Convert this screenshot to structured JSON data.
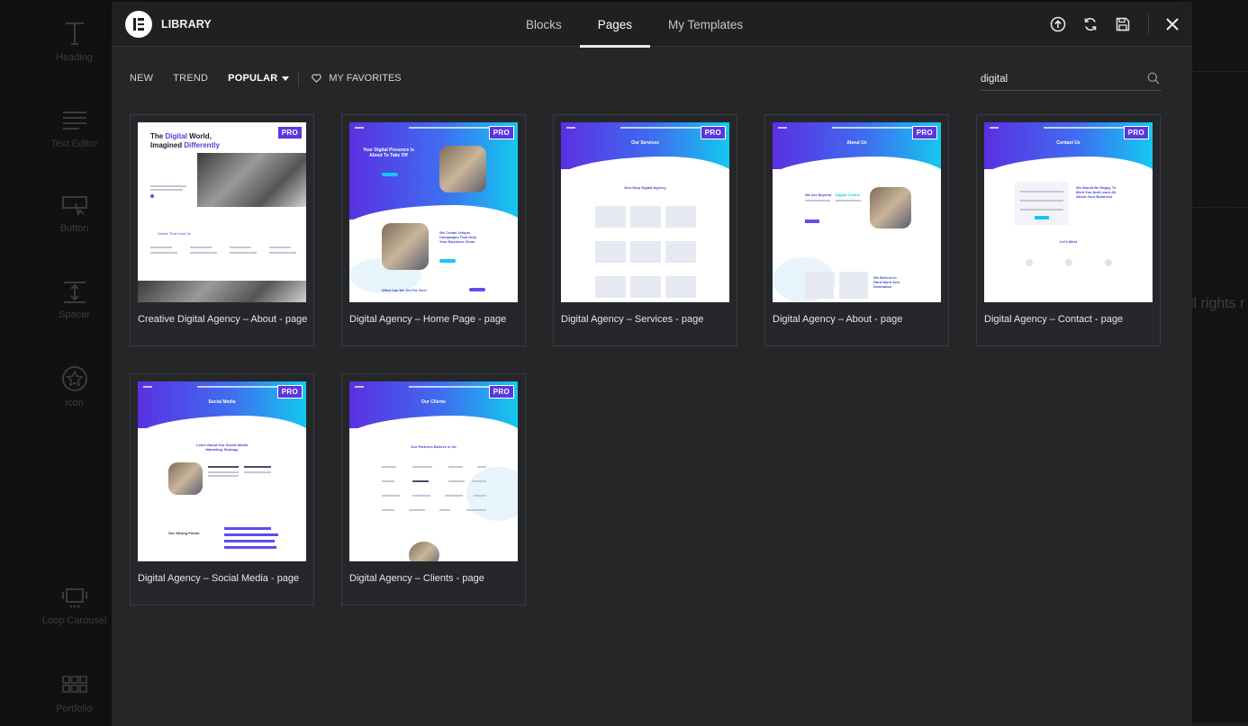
{
  "editor_sidebar": {
    "widgets": [
      {
        "label": "Heading",
        "icon": "heading-icon"
      },
      {
        "label": "Text Editor",
        "icon": "text-editor-icon"
      },
      {
        "label": "Button",
        "icon": "button-icon"
      },
      {
        "label": "Spacer",
        "icon": "spacer-icon"
      },
      {
        "label": "Icon",
        "icon": "star-icon"
      },
      {
        "label": "Loop Carousel",
        "icon": "carousel-icon"
      },
      {
        "label": "Portfolio",
        "icon": "grid-icon"
      }
    ]
  },
  "canvas": {
    "footer_text": "ll rights r"
  },
  "modal": {
    "brand": "LIBRARY",
    "tabs": [
      {
        "label": "Blocks",
        "active": false
      },
      {
        "label": "Pages",
        "active": true
      },
      {
        "label": "My Templates",
        "active": false
      }
    ],
    "header_icons": [
      "upload-icon",
      "sync-icon",
      "save-icon",
      "close-icon"
    ],
    "filters": {
      "new": "NEW",
      "trend": "TREND",
      "popular": "POPULAR",
      "favorites": "MY FAVORITES"
    },
    "search": {
      "value": "digital",
      "placeholder": "Search"
    },
    "badge": "PRO",
    "templates": [
      {
        "title": "Creative Digital Agency – About - page",
        "pro": true
      },
      {
        "title": "Digital Agency – Home Page - page",
        "pro": true
      },
      {
        "title": "Digital Agency – Services - page",
        "pro": true
      },
      {
        "title": "Digital Agency – About - page",
        "pro": true
      },
      {
        "title": "Digital Agency – Contact - page",
        "pro": true
      },
      {
        "title": "Digital Agency – Social Media - page",
        "pro": true
      },
      {
        "title": "Digital Agency – Clients - page",
        "pro": true
      }
    ],
    "thumb_text": {
      "t0_l1a": "The ",
      "t0_l1b": "Digital",
      "t0_l1c": " World,",
      "t0_l2a": "Imagined ",
      "t0_l2b": "Differently",
      "t0_values": "Values That Lead Us",
      "t1_h1": "Your Digital Presence Is",
      "t1_h2": "About To Take Off",
      "t1_h3": "We Create Unique",
      "t1_h4": "Campaigns That Help",
      "t1_h5": "Your Business Grow",
      "t1_h6": "What Can We Do For You?",
      "t2_hero": "Our Services",
      "t2_h": "One-Stop Digital Agency",
      "t3_hero": "About Us",
      "t3_h1": "We Are Beyond",
      "t3_h2": "Digital Centric",
      "t3_h3": "We Believe In",
      "t3_h4": "Hard Work And",
      "t3_h5": "Dedication",
      "t4_hero": "Contact Us",
      "t4_h1": "We Would Be Happy To",
      "t4_h2": "Meet You And Learn All",
      "t4_h3": "About Your Business",
      "t4_h4": "Let's Meet",
      "t5_hero": "Social Media",
      "t5_h1": "Learn About Our Social Media",
      "t5_h2": "Marketing Strategy",
      "t5_h3": "Our Strong Points",
      "t6_hero": "Our Clients",
      "t6_h": "Our Partners Believe In Us"
    }
  },
  "colors": {
    "accent": "#5b36e0",
    "hero_start": "#5a30e2",
    "hero_end": "#13c9ef",
    "modal_bg": "#252628",
    "header_bg": "#1f2022"
  }
}
